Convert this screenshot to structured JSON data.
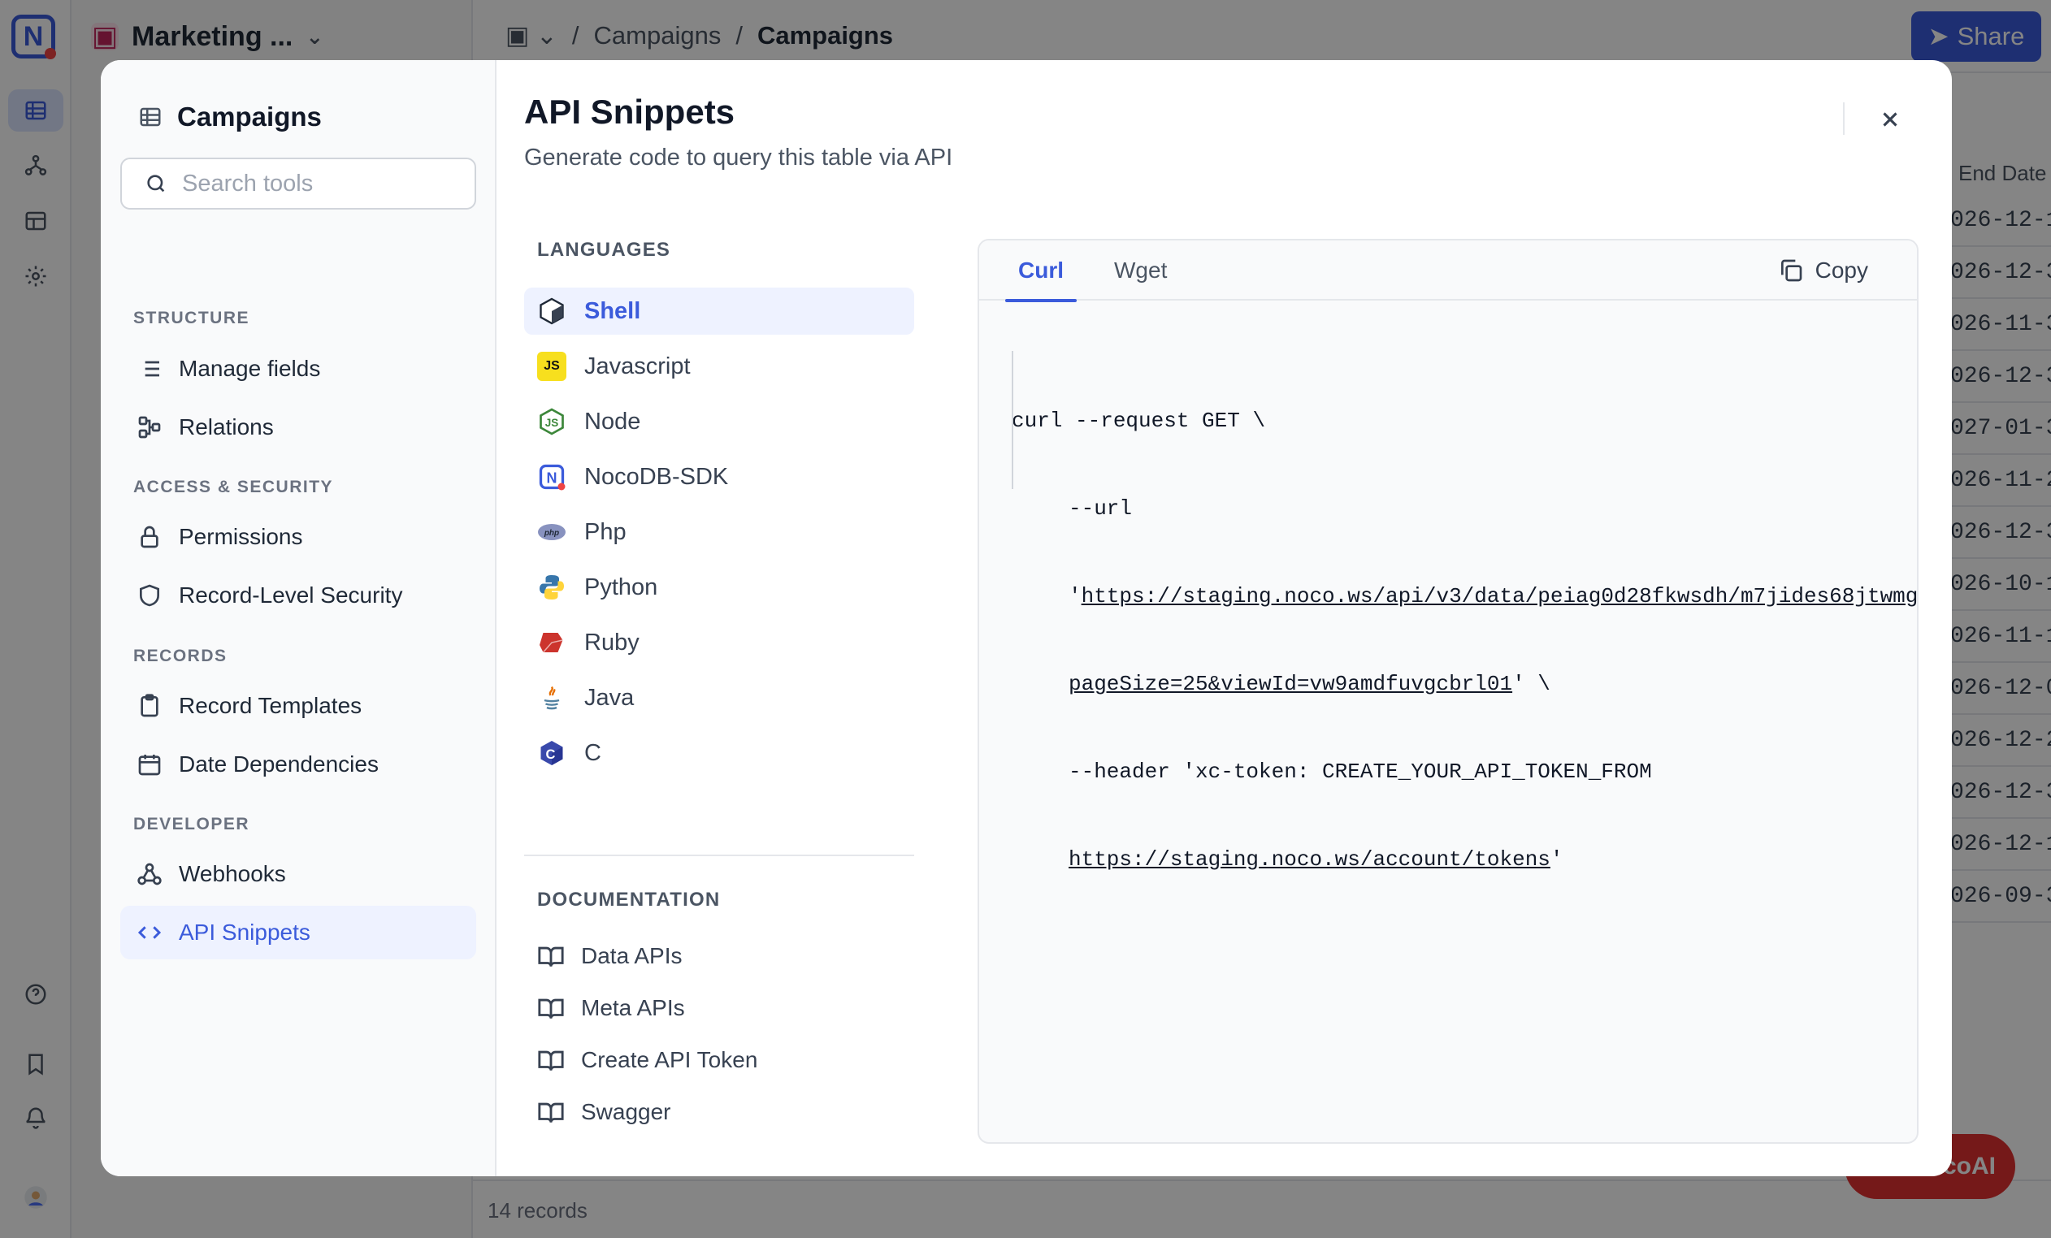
{
  "app": {
    "project_name": "Marketing ...",
    "breadcrumb": [
      "Campaigns",
      "Campaigns"
    ],
    "share_label": "Share",
    "grid_header": "End Date",
    "grid_dates": [
      "026-12-1",
      "026-12-3",
      "026-11-3",
      "026-12-3",
      "027-01-3",
      "026-11-2",
      "026-12-3",
      "026-10-1",
      "026-11-1",
      "026-12-0",
      "026-12-2",
      "026-12-3",
      "026-12-1",
      "026-09-3"
    ],
    "records_count": "14 records",
    "ai_button": "coAI"
  },
  "modal": {
    "left": {
      "title": "Campaigns",
      "search_placeholder": "Search tools",
      "sections": [
        {
          "label": "STRUCTURE",
          "items": [
            "Manage fields",
            "Relations"
          ]
        },
        {
          "label": "ACCESS & SECURITY",
          "items": [
            "Permissions",
            "Record-Level Security"
          ]
        },
        {
          "label": "RECORDS",
          "items": [
            "Record Templates",
            "Date Dependencies"
          ]
        },
        {
          "label": "DEVELOPER",
          "items": [
            "Webhooks",
            "API Snippets"
          ]
        }
      ]
    },
    "title": "API Snippets",
    "subtitle": "Generate code to query this table via API",
    "languages_label": "LANGUAGES",
    "languages": [
      "Shell",
      "Javascript",
      "Node",
      "NocoDB-SDK",
      "Php",
      "Python",
      "Ruby",
      "Java",
      "C"
    ],
    "documentation_label": "DOCUMENTATION",
    "docs": [
      "Data APIs",
      "Meta APIs",
      "Create API Token",
      "Swagger"
    ],
    "tabs": [
      "Curl",
      "Wget"
    ],
    "copy_label": "Copy",
    "code": {
      "line1": "curl --request GET \\",
      "line2": "--url",
      "line3_prefix": "'",
      "line3_url": "https://staging.noco.ws/api/v3/data/peiag0d28fkwsdh/m7jides68jtwmg",
      "line4_url": "pageSize=25&viewId=vw9amdfuvgcbrl01",
      "line4_suffix": "' \\",
      "line5": "--header 'xc-token: CREATE_YOUR_API_TOKEN_FROM",
      "line6_url": "https://staging.noco.ws/account/tokens",
      "line6_suffix": "'"
    }
  }
}
